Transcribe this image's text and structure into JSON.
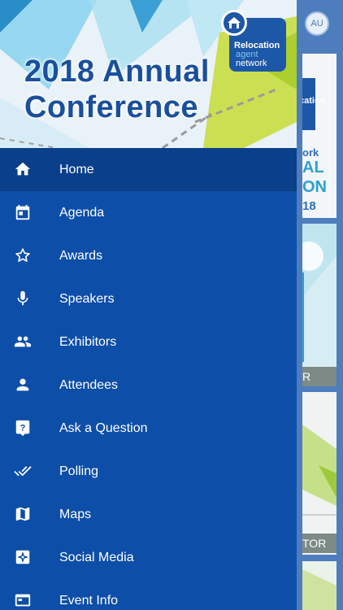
{
  "header": {
    "avatar_initials": "AU",
    "conference_title_line1": "2018 Annual",
    "conference_title_line2": "Conference",
    "logo": {
      "line1": "Relocation",
      "line2": "agent",
      "line3": "network"
    }
  },
  "background_cards": [
    {
      "lines": [
        "ork",
        "AL",
        "ON",
        "18"
      ]
    },
    {
      "strip": "R"
    },
    {
      "strip": "TOR"
    }
  ],
  "menu": {
    "items": [
      {
        "label": "Home",
        "icon": "home-icon",
        "active": true
      },
      {
        "label": "Agenda",
        "icon": "calendar-icon"
      },
      {
        "label": "Awards",
        "icon": "star-icon"
      },
      {
        "label": "Speakers",
        "icon": "microphone-icon"
      },
      {
        "label": "Exhibitors",
        "icon": "group-icon"
      },
      {
        "label": "Attendees",
        "icon": "person-icon"
      },
      {
        "label": "Ask a Question",
        "icon": "question-icon"
      },
      {
        "label": "Polling",
        "icon": "double-check-icon"
      },
      {
        "label": "Maps",
        "icon": "map-icon"
      },
      {
        "label": "Social Media",
        "icon": "social-icon"
      },
      {
        "label": "Event Info",
        "icon": "event-info-icon"
      }
    ]
  },
  "colors": {
    "drawer": "#0d4ea8",
    "active_item": "#0a3f8a",
    "title_blue": "#1a4f9c"
  }
}
